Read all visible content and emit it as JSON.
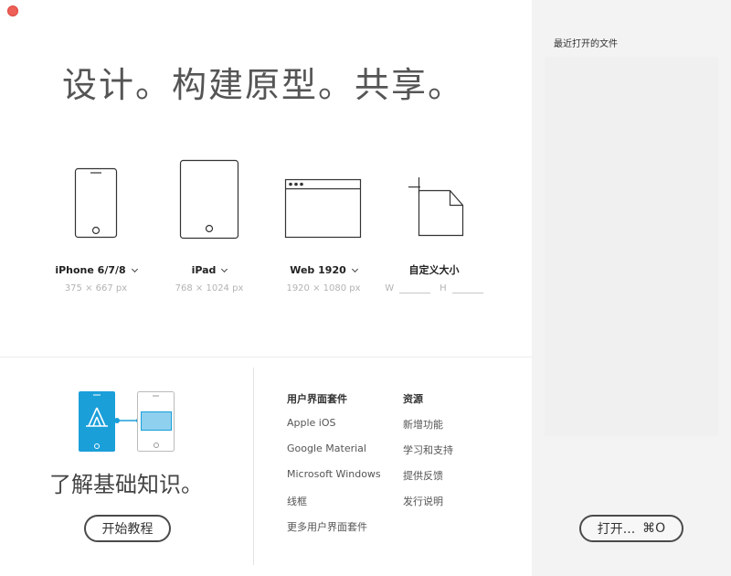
{
  "headline": "设计。构建原型。共享。",
  "presets": [
    {
      "label": "iPhone 6/7/8",
      "dims": "375 × 667 px"
    },
    {
      "label": "iPad",
      "dims": "768 × 1024 px"
    },
    {
      "label": "Web 1920",
      "dims": "1920 × 1080 px"
    }
  ],
  "custom": {
    "label": "自定义大小",
    "w_label": "W",
    "h_label": "H"
  },
  "learn": {
    "title": "了解基础知识。",
    "button": "开始教程"
  },
  "ui_kits": {
    "heading": "用户界面套件",
    "items": [
      "Apple iOS",
      "Google Material",
      "Microsoft Windows",
      "线框",
      "更多用户界面套件"
    ]
  },
  "resources": {
    "heading": "资源",
    "items": [
      "新增功能",
      "学习和支持",
      "提供反馈",
      "发行说明"
    ]
  },
  "recent": {
    "title": "最近打开的文件"
  },
  "open": {
    "label": "打开...",
    "shortcut": "⌘O"
  },
  "colors": {
    "accent": "#1a9fd9",
    "close": "#ee5f57"
  },
  "icons": [
    "phone-icon",
    "tablet-icon",
    "browser-window-icon",
    "custom-page-icon",
    "chevron-down-icon",
    "tutorial-illustration"
  ]
}
